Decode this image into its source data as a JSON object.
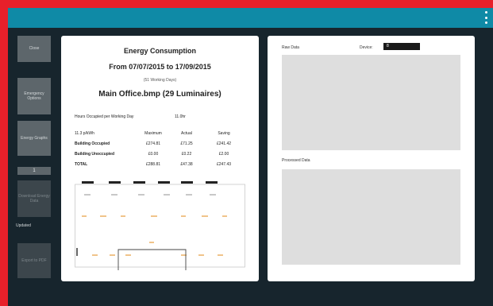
{
  "sidebar": {
    "close": "Close",
    "emergency": "Emergency Options",
    "energy": "Energy Graphs",
    "small": "1",
    "dim1": "Download Energy Data",
    "updated": "Updated",
    "dim2": "Export to PDF"
  },
  "report": {
    "title": "Energy Consumption",
    "dates": "From 07/07/2015 to 17/09/2015",
    "days": "(51 Working Days)",
    "office": "Main Office.bmp (29 Luminaires)",
    "hours_label": "Hours Occupied per Working Day",
    "hours_value": "11.0hr",
    "headers": [
      "11.3 p/kWh",
      "Maximum",
      "Actual",
      "Saving"
    ],
    "rows": [
      [
        "Building Occupied",
        "£274.81",
        "£71.25",
        "£241.42"
      ],
      [
        "Building Unoccupied",
        "£0.00",
        "£0.22",
        "£2.00"
      ],
      [
        "TOTAL",
        "£288.81",
        "£47.38",
        "£247.43"
      ]
    ]
  },
  "data": {
    "raw": "Raw Data",
    "device_label": "Device:",
    "device_value": "8",
    "processed": "Processed Data"
  }
}
